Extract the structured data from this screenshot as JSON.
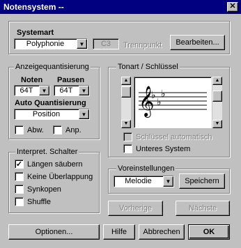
{
  "window": {
    "title": "Notensystem --",
    "close_glyph": "✕"
  },
  "systemart": {
    "label": "Systemart",
    "mode_value": "Polyphonie",
    "split_value": "C3",
    "split_label": "Trennpunkt",
    "edit_button": "Bearbeiten..."
  },
  "quantize": {
    "legend": "Anzeigequantisierung",
    "notes_label": "Noten",
    "notes_value": "64T",
    "rests_label": "Pausen",
    "rests_value": "64T",
    "auto_label": "Auto Quantisierung",
    "auto_value": "Position",
    "abw_label": "Abw.",
    "anp_label": "Anp."
  },
  "interpret": {
    "legend": "Interpret. Schalter",
    "items": [
      {
        "label": "Längen säubern",
        "checked": "✓"
      },
      {
        "label": "Keine Überlappung",
        "checked": ""
      },
      {
        "label": "Synkopen",
        "checked": ""
      },
      {
        "label": "Shuffle",
        "checked": ""
      }
    ]
  },
  "key": {
    "legend": "Tonart / Schlüssel",
    "clef_glyph": "𝄞",
    "auto_clef_label": "Schlüssel automatisch",
    "lower_system_label": "Unteres System"
  },
  "presets": {
    "legend": "Voreinstellungen",
    "value": "Melodie",
    "save_button": "Speichern"
  },
  "nav": {
    "prev": "Vorherige",
    "next": "Nächste"
  },
  "footer": {
    "options": "Optionen...",
    "help": "Hilfe",
    "cancel": "Abbrechen",
    "ok": "OK"
  },
  "icons": {
    "arrow_down": "▼",
    "arrow_up": "▲"
  }
}
